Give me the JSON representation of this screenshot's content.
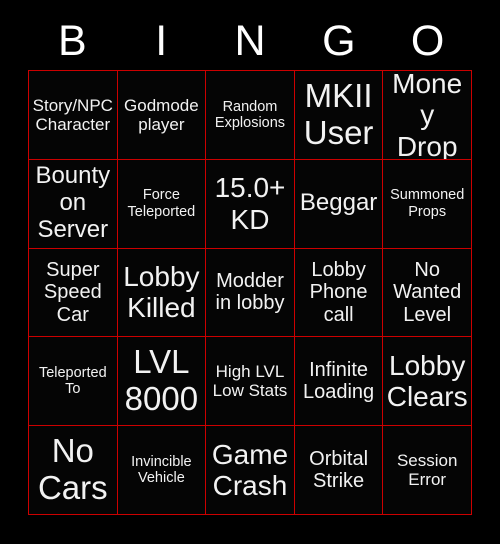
{
  "card": {
    "title": "BINGO",
    "background_color": "#000000",
    "grid_line_color": "#cc0000",
    "text_color": "#f2f2f2",
    "header_letters": [
      "B",
      "I",
      "N",
      "G",
      "O"
    ],
    "columns": 5,
    "rows": 5,
    "cells": [
      {
        "text": "Story/NPC Character",
        "size": "s"
      },
      {
        "text": "Godmode player",
        "size": "s"
      },
      {
        "text": "Random Explosions",
        "size": "xs"
      },
      {
        "text": "MKII User",
        "size": "xxl"
      },
      {
        "text": "Money Drop",
        "size": "xl"
      },
      {
        "text": "Bounty on Server",
        "size": "l"
      },
      {
        "text": "Force Teleported",
        "size": "xs"
      },
      {
        "text": "15.0+ KD",
        "size": "xl"
      },
      {
        "text": "Beggar",
        "size": "l"
      },
      {
        "text": "Summoned Props",
        "size": "xs"
      },
      {
        "text": "Super Speed Car",
        "size": "m"
      },
      {
        "text": "Lobby Killed",
        "size": "xl"
      },
      {
        "text": "Modder in lobby",
        "size": "m"
      },
      {
        "text": "Lobby Phone call",
        "size": "m"
      },
      {
        "text": "No Wanted Level",
        "size": "m"
      },
      {
        "text": "Teleported To",
        "size": "xs"
      },
      {
        "text": "LVL 8000",
        "size": "xxl"
      },
      {
        "text": "High LVL Low Stats",
        "size": "s"
      },
      {
        "text": "Infinite Loading",
        "size": "m"
      },
      {
        "text": "Lobby Clears",
        "size": "xl"
      },
      {
        "text": "No Cars",
        "size": "xxl"
      },
      {
        "text": "Invincible Vehicle",
        "size": "xs"
      },
      {
        "text": "Game Crash",
        "size": "xl"
      },
      {
        "text": "Orbital Strike",
        "size": "m"
      },
      {
        "text": "Session Error",
        "size": "s"
      }
    ]
  }
}
